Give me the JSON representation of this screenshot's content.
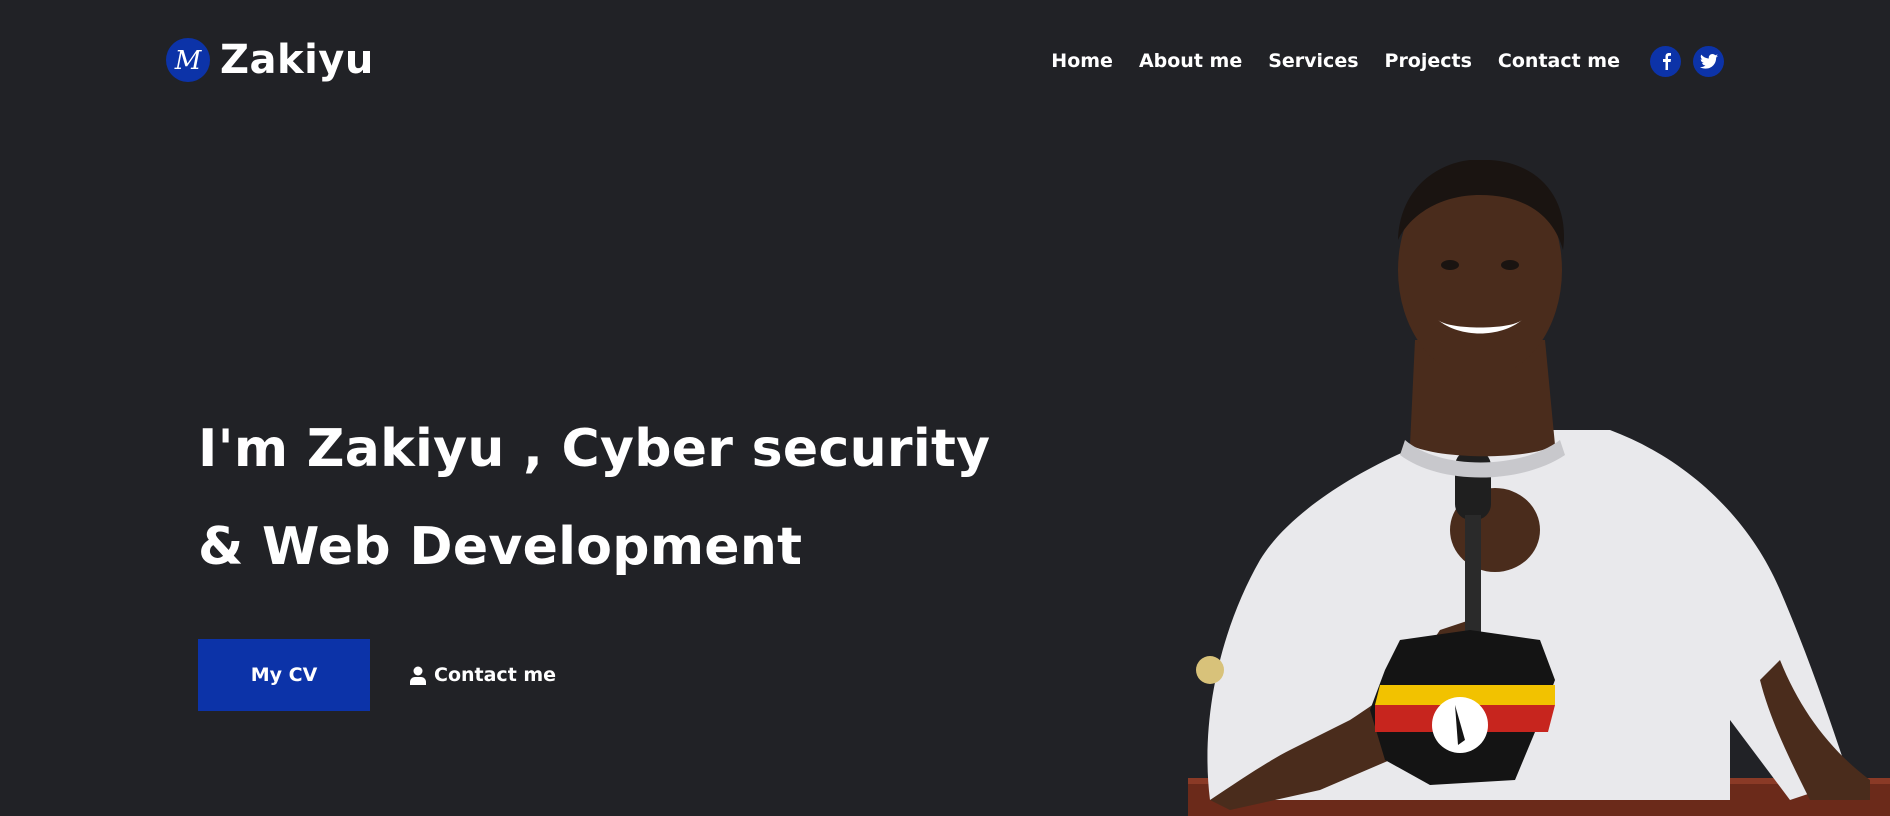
{
  "brand": {
    "logo_letter": "M",
    "name": "Zakiyu"
  },
  "nav": {
    "items": [
      {
        "label": "Home"
      },
      {
        "label": "About me"
      },
      {
        "label": "Services"
      },
      {
        "label": "Projects"
      },
      {
        "label": "Contact me"
      }
    ],
    "social": [
      {
        "icon": "facebook-icon",
        "glyph": "f"
      },
      {
        "icon": "twitter-icon"
      }
    ]
  },
  "hero": {
    "title_line1": "I'm Zakiyu , Cyber security",
    "title_line2": "& Web Development",
    "cv_button": "My CV",
    "contact_link": "Contact me",
    "contact_icon": "user-icon"
  },
  "colors": {
    "background": "#212226",
    "accent": "#0c33a8",
    "text": "#ffffff"
  }
}
